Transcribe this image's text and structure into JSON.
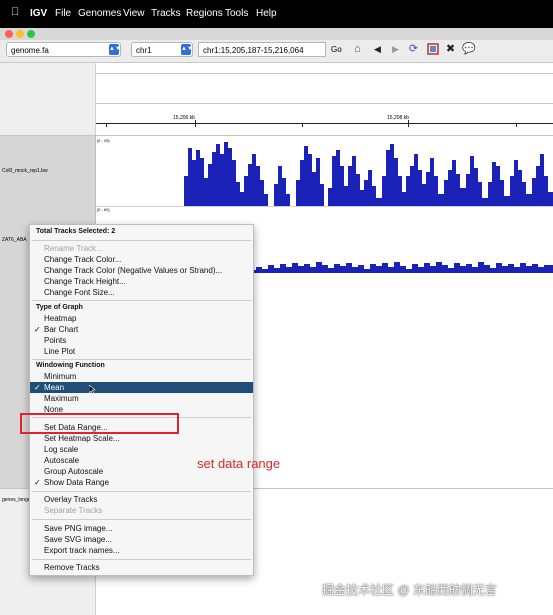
{
  "menubar": {
    "apple": "",
    "items": [
      "IGV",
      "File",
      "Genomes",
      "View",
      "Tracks",
      "Regions",
      "Tools",
      "Help"
    ]
  },
  "window": {
    "traffic_lights": [
      "#ff5f57",
      "#febc2e",
      "#28c840"
    ]
  },
  "toolbar": {
    "genome": "genome.fa",
    "chromosome": "chr1",
    "locus": "chr1:15,205,187-15,216,064",
    "go_label": "Go"
  },
  "ruler": {
    "tick_labels": [
      "15,206 kb",
      "15,208 kb"
    ]
  },
  "tracks": [
    {
      "name": "Col0_mock_rep1.bw",
      "range": "[0 - 29]",
      "color": "#1b22b8"
    },
    {
      "name": "ZAT6_ABA",
      "range": "[0 - 60]",
      "color": "#1b22b8"
    },
    {
      "name": "genes_longe",
      "range": ""
    }
  ],
  "context_menu": {
    "title": "Total Tracks Selected: 2",
    "group1": [
      "Rename Track...",
      "Change Track Color...",
      "Change Track Color (Negative Values or Strand)...",
      "Change Track Height...",
      "Change Font Size..."
    ],
    "graph_header": "Type of Graph",
    "graph_items": [
      "Heatmap",
      "Bar Chart",
      "Points",
      "Line Plot"
    ],
    "graph_checked": "Bar Chart",
    "window_header": "Windowing Function",
    "window_items": [
      "Minimum",
      "Mean",
      "Maximum",
      "None"
    ],
    "window_checked": "Mean",
    "range_items": [
      "Set Data Range...",
      "Set Heatmap Scale...",
      "Log scale",
      "Autoscale",
      "Group Autoscale",
      "Show Data Range"
    ],
    "range_checked": "Show Data Range",
    "overlay_items": [
      "Overlay Tracks",
      "Separate Tracks"
    ],
    "export_items": [
      "Save PNG image...",
      "Save SVG image...",
      "Export track names..."
    ],
    "remove_label": "Remove Tracks"
  },
  "annotation": {
    "text": "set data range",
    "color": "#e0242b"
  },
  "watermark": "掘金技术社区 @ 东船西舫惆无言"
}
